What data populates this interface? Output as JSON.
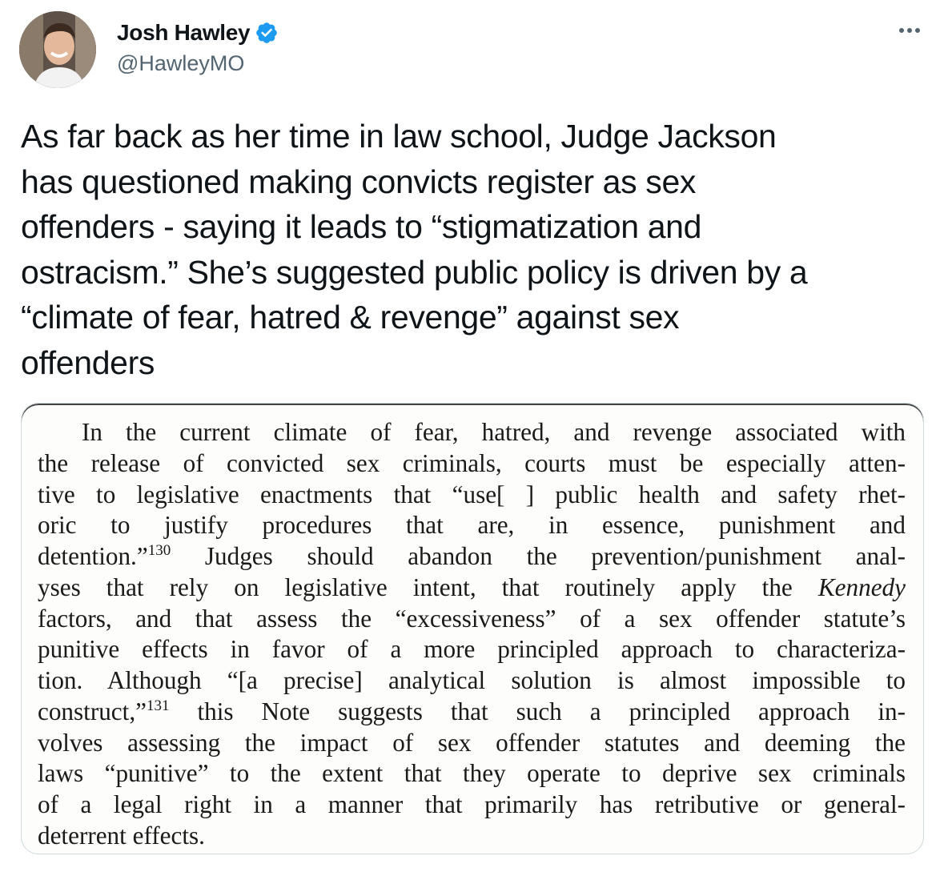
{
  "author": {
    "display_name": "Josh Hawley",
    "handle": "@HawleyMO",
    "verified": true,
    "verified_icon": "verified-badge-icon",
    "verified_color": "#1d9bf0"
  },
  "more_menu_icon": "more-horizontal-icon",
  "tweet": {
    "text": "As far back as her time in law school, Judge Jackson\nhas questioned making convicts register as sex\noffenders - saying it leads to “stigmatization and\nostracism.” She’s suggested public policy is driven by a\n“climate of fear, hatred & revenge” against sex\noffenders"
  },
  "media": {
    "type": "scanned-document-excerpt",
    "lines": [
      {
        "segments": [
          {
            "text": "In the current climate of fear, hatred, and revenge associated with"
          }
        ]
      },
      {
        "segments": [
          {
            "text": "the release of convicted sex criminals, courts must be especially atten-"
          }
        ]
      },
      {
        "segments": [
          {
            "text": "tive to legislative enactments that “use[ ] public health and safety rhet-"
          }
        ]
      },
      {
        "segments": [
          {
            "text": "oric to justify procedures that are, in essence, punishment and"
          }
        ]
      },
      {
        "segments": [
          {
            "text": "detention.”"
          },
          {
            "text": "130",
            "style": "sup"
          },
          {
            "text": " Judges should abandon the prevention/punishment anal-"
          }
        ]
      },
      {
        "segments": [
          {
            "text": "yses that rely on legislative intent, that routinely apply the "
          },
          {
            "text": "Kennedy",
            "style": "italic"
          }
        ]
      },
      {
        "segments": [
          {
            "text": "factors, and that assess the “excessiveness” of a sex offender statute’s"
          }
        ]
      },
      {
        "segments": [
          {
            "text": "punitive effects in favor of a more principled approach to characteriza-"
          }
        ]
      },
      {
        "segments": [
          {
            "text": "tion. Although “[a precise] analytical solution is almost impossible to"
          }
        ]
      },
      {
        "segments": [
          {
            "text": "construct,”"
          },
          {
            "text": "131",
            "style": "sup"
          },
          {
            "text": " this Note suggests that such a principled approach in-"
          }
        ]
      },
      {
        "segments": [
          {
            "text": "volves assessing the impact of sex offender statutes and deeming the"
          }
        ]
      },
      {
        "segments": [
          {
            "text": "laws “punitive” to the extent that they operate to deprive sex criminals"
          }
        ]
      },
      {
        "segments": [
          {
            "text": "of a legal right in a manner that primarily has retributive or general-"
          }
        ]
      },
      {
        "segments": [
          {
            "text": "deterrent effects."
          }
        ]
      }
    ]
  }
}
